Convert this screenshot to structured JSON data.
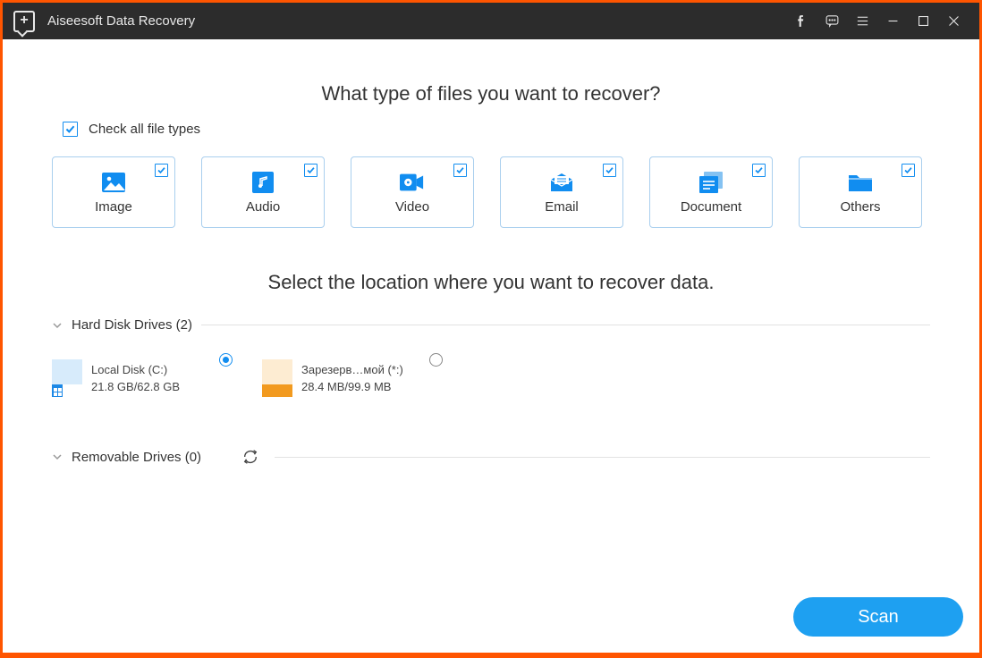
{
  "titlebar": {
    "title": "Aiseesoft Data Recovery"
  },
  "headings": {
    "filetypes": "What type of files you want to recover?",
    "location": "Select the location where you want to recover data."
  },
  "check_all": {
    "label": "Check all file types",
    "checked": true
  },
  "types": [
    {
      "key": "image",
      "label": "Image",
      "checked": true
    },
    {
      "key": "audio",
      "label": "Audio",
      "checked": true
    },
    {
      "key": "video",
      "label": "Video",
      "checked": true
    },
    {
      "key": "email",
      "label": "Email",
      "checked": true
    },
    {
      "key": "document",
      "label": "Document",
      "checked": true
    },
    {
      "key": "others",
      "label": "Others",
      "checked": true
    }
  ],
  "sections": {
    "hdd": "Hard Disk Drives (2)",
    "removable": "Removable Drives (0)"
  },
  "drives": [
    {
      "name": "Local Disk (C:)",
      "usage": "21.8 GB/62.8 GB",
      "selected": true,
      "fill_pct": 35,
      "tint": "#d7ebfb",
      "bar": "#1c88e6",
      "win": true
    },
    {
      "name": "Зарезерв…мой (*:)",
      "usage": "28.4 MB/99.9 MB",
      "selected": false,
      "fill_pct": 100,
      "tint": "#fdecd2",
      "bar": "#f29a1f",
      "win": false
    }
  ],
  "scan_label": "Scan"
}
